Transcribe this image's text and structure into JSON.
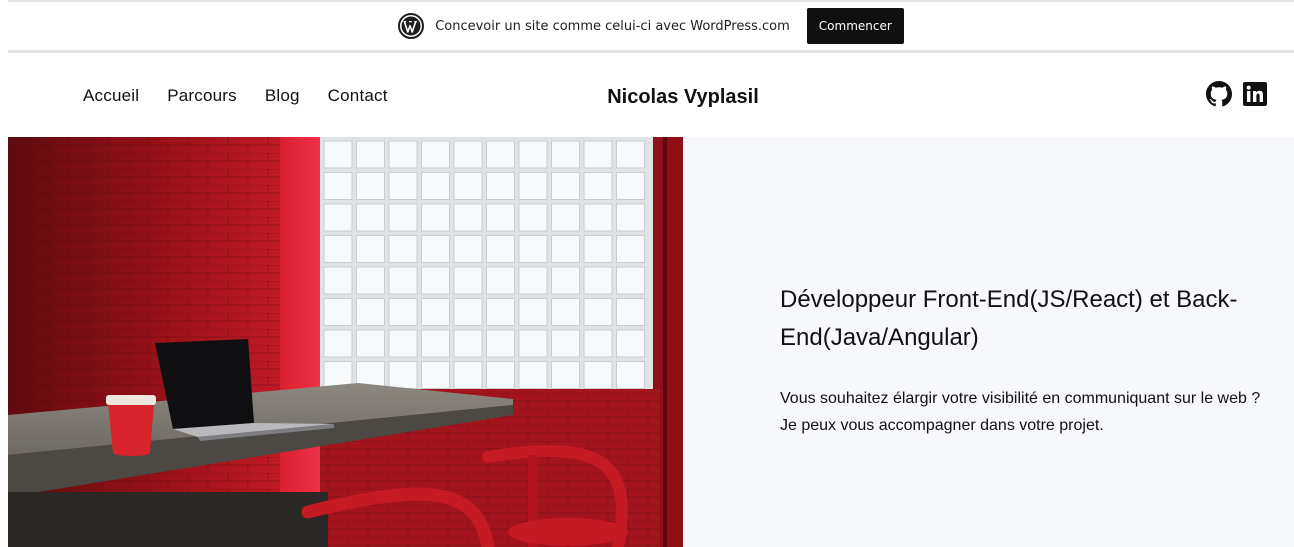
{
  "banner": {
    "text": "Concevoir un site comme celui-ci avec WordPress.com",
    "button_label": "Commencer",
    "logo_icon": "wordpress-logo-icon"
  },
  "header": {
    "nav": [
      "Accueil",
      "Parcours",
      "Blog",
      "Contact"
    ],
    "site_title": "Nicolas Vyplasil",
    "social": [
      "github-icon",
      "linkedin-icon"
    ]
  },
  "hero": {
    "image": "red-room-laptop-photo",
    "heading": "Développeur Front-End(JS/React) et Back-End(Java/Angular)",
    "description": "Vous souhaitez élargir votre visibilité en communiquant sur le web ? Je peux vous accompagner dans votre projet."
  },
  "colors": {
    "accent_red": "#c41a22",
    "hero_text_bg": "#f7f8fc",
    "button_bg": "#101010"
  }
}
